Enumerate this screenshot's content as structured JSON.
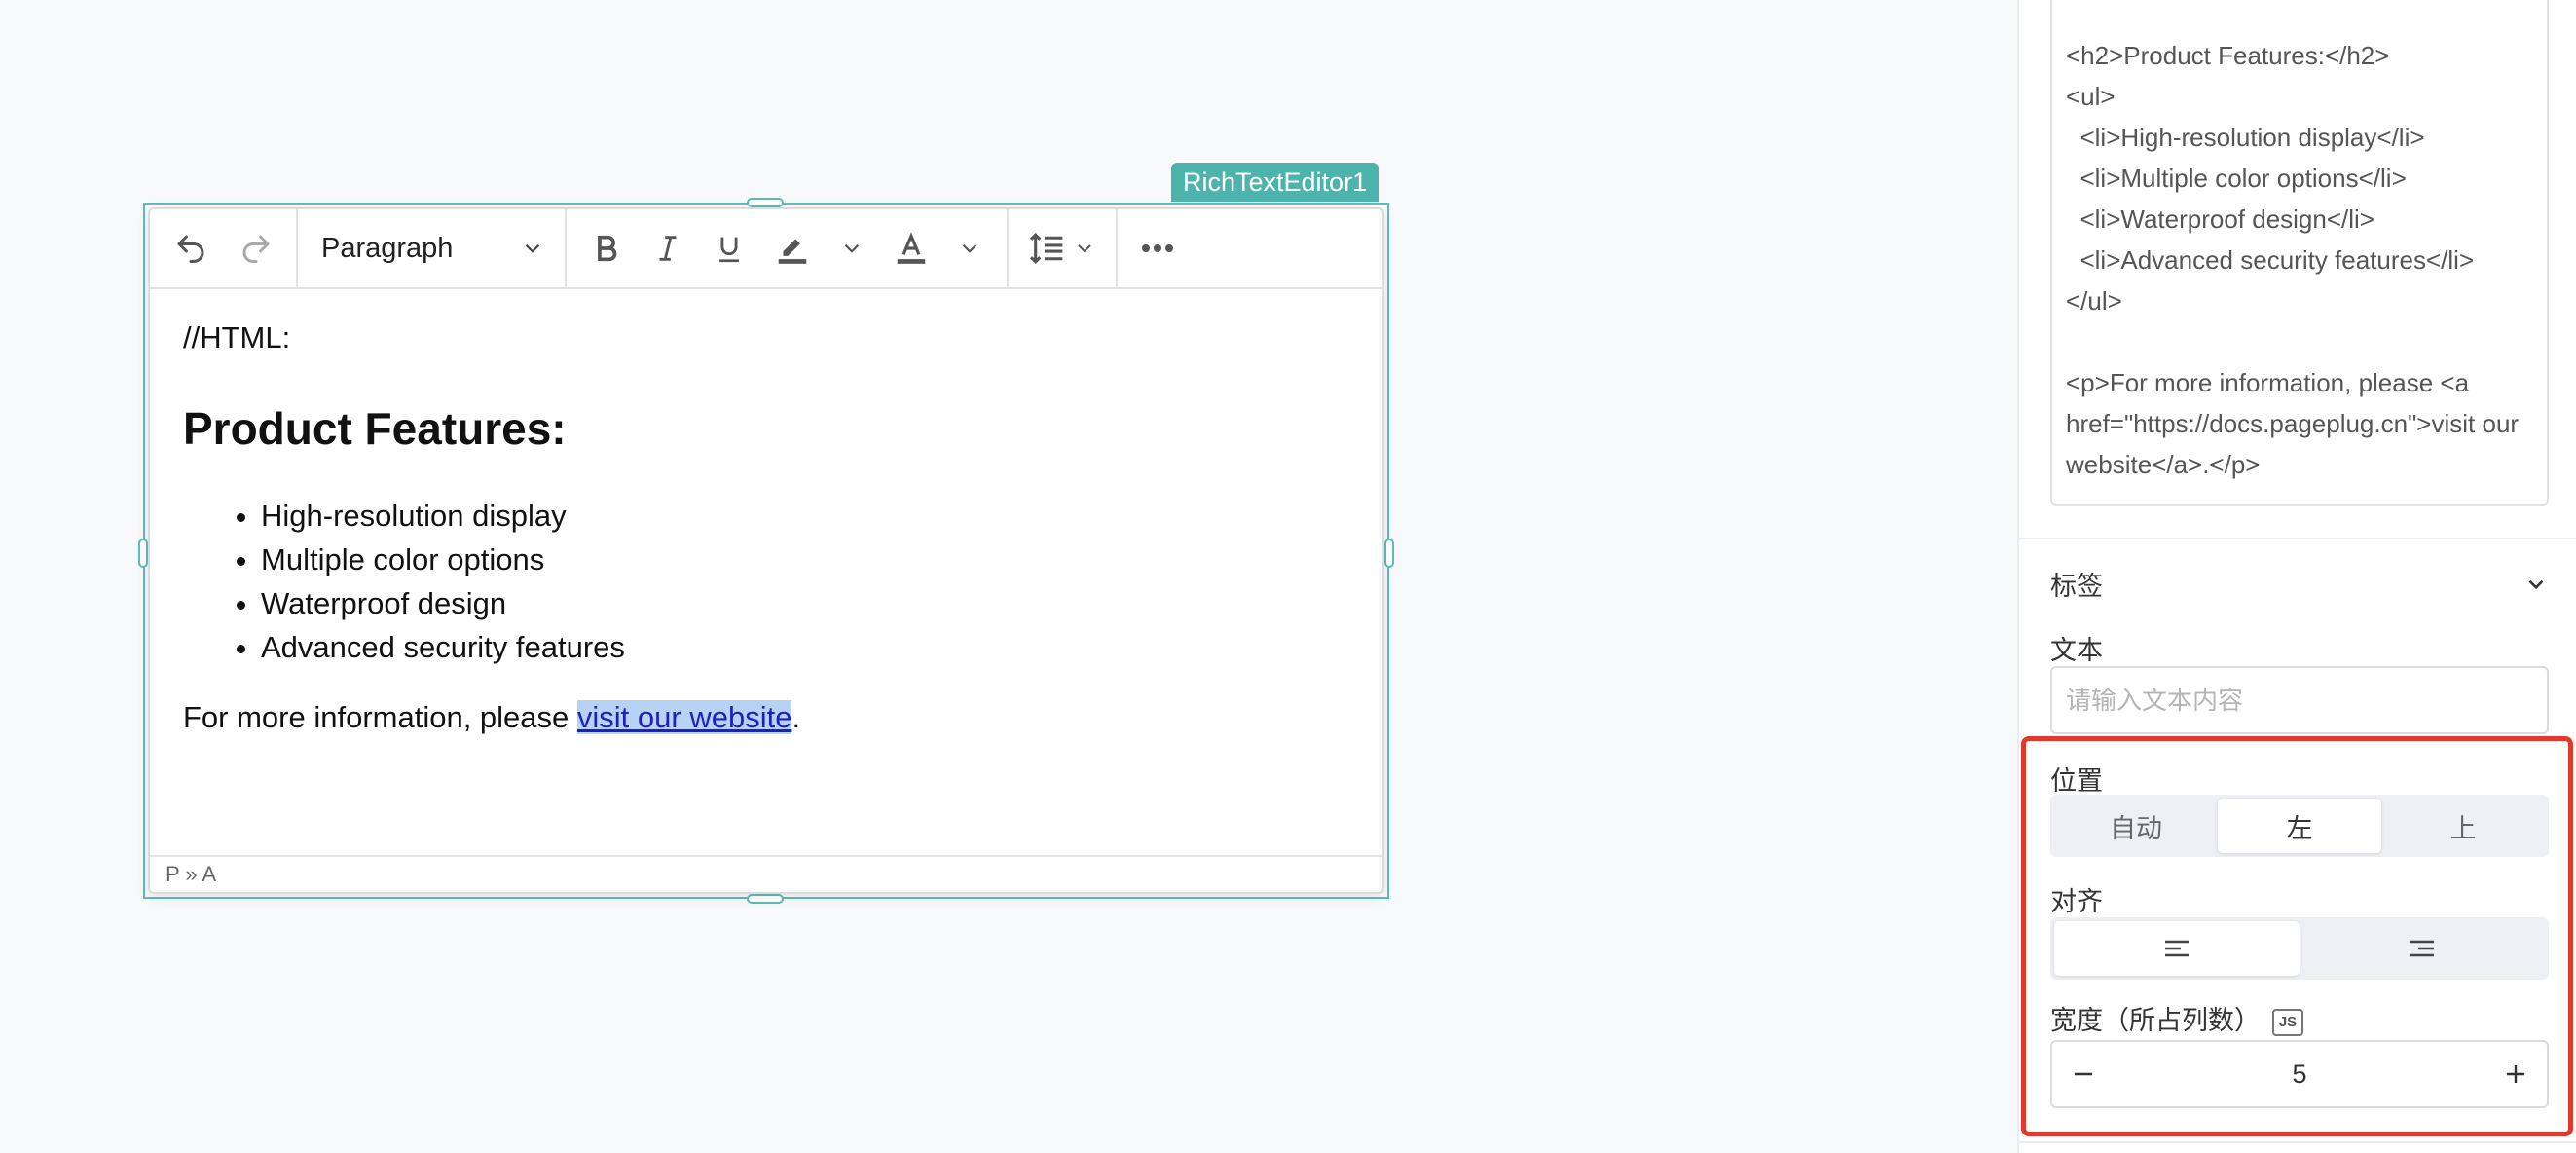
{
  "widget": {
    "name": "RichTextEditor1",
    "toolbar": {
      "block_format": "Paragraph"
    },
    "content": {
      "code_line": "//HTML:",
      "heading": "Product Features:",
      "list_items": [
        "High-resolution display",
        "Multiple color options",
        "Waterproof design",
        "Advanced security features"
      ],
      "info_prefix": "For more information, please ",
      "link_text": "visit our website",
      "info_suffix": "."
    },
    "statusbar": "P » A"
  },
  "panel": {
    "source_code": "<h2>Product Features:</h2>\n<ul>\n  <li>High-resolution display</li>\n  <li>Multiple color options</li>\n  <li>Waterproof design</li>\n  <li>Advanced security features</li>\n</ul>\n\n<p>For more information, please <a href=\"https://docs.pageplug.cn\">visit our website</a>.</p>",
    "label_section": "标签",
    "text_label": "文本",
    "text_placeholder": "请输入文本内容",
    "position_label": "位置",
    "position_options": [
      "自动",
      "左",
      "上"
    ],
    "position_selected": "左",
    "align_label": "对齐",
    "width_label": "宽度（所占列数）",
    "js_badge": "JS",
    "width_value": "5"
  },
  "colors": {
    "accent": "#4db3ad",
    "highlight": "#e3392c",
    "link": "#1f1fbf"
  }
}
